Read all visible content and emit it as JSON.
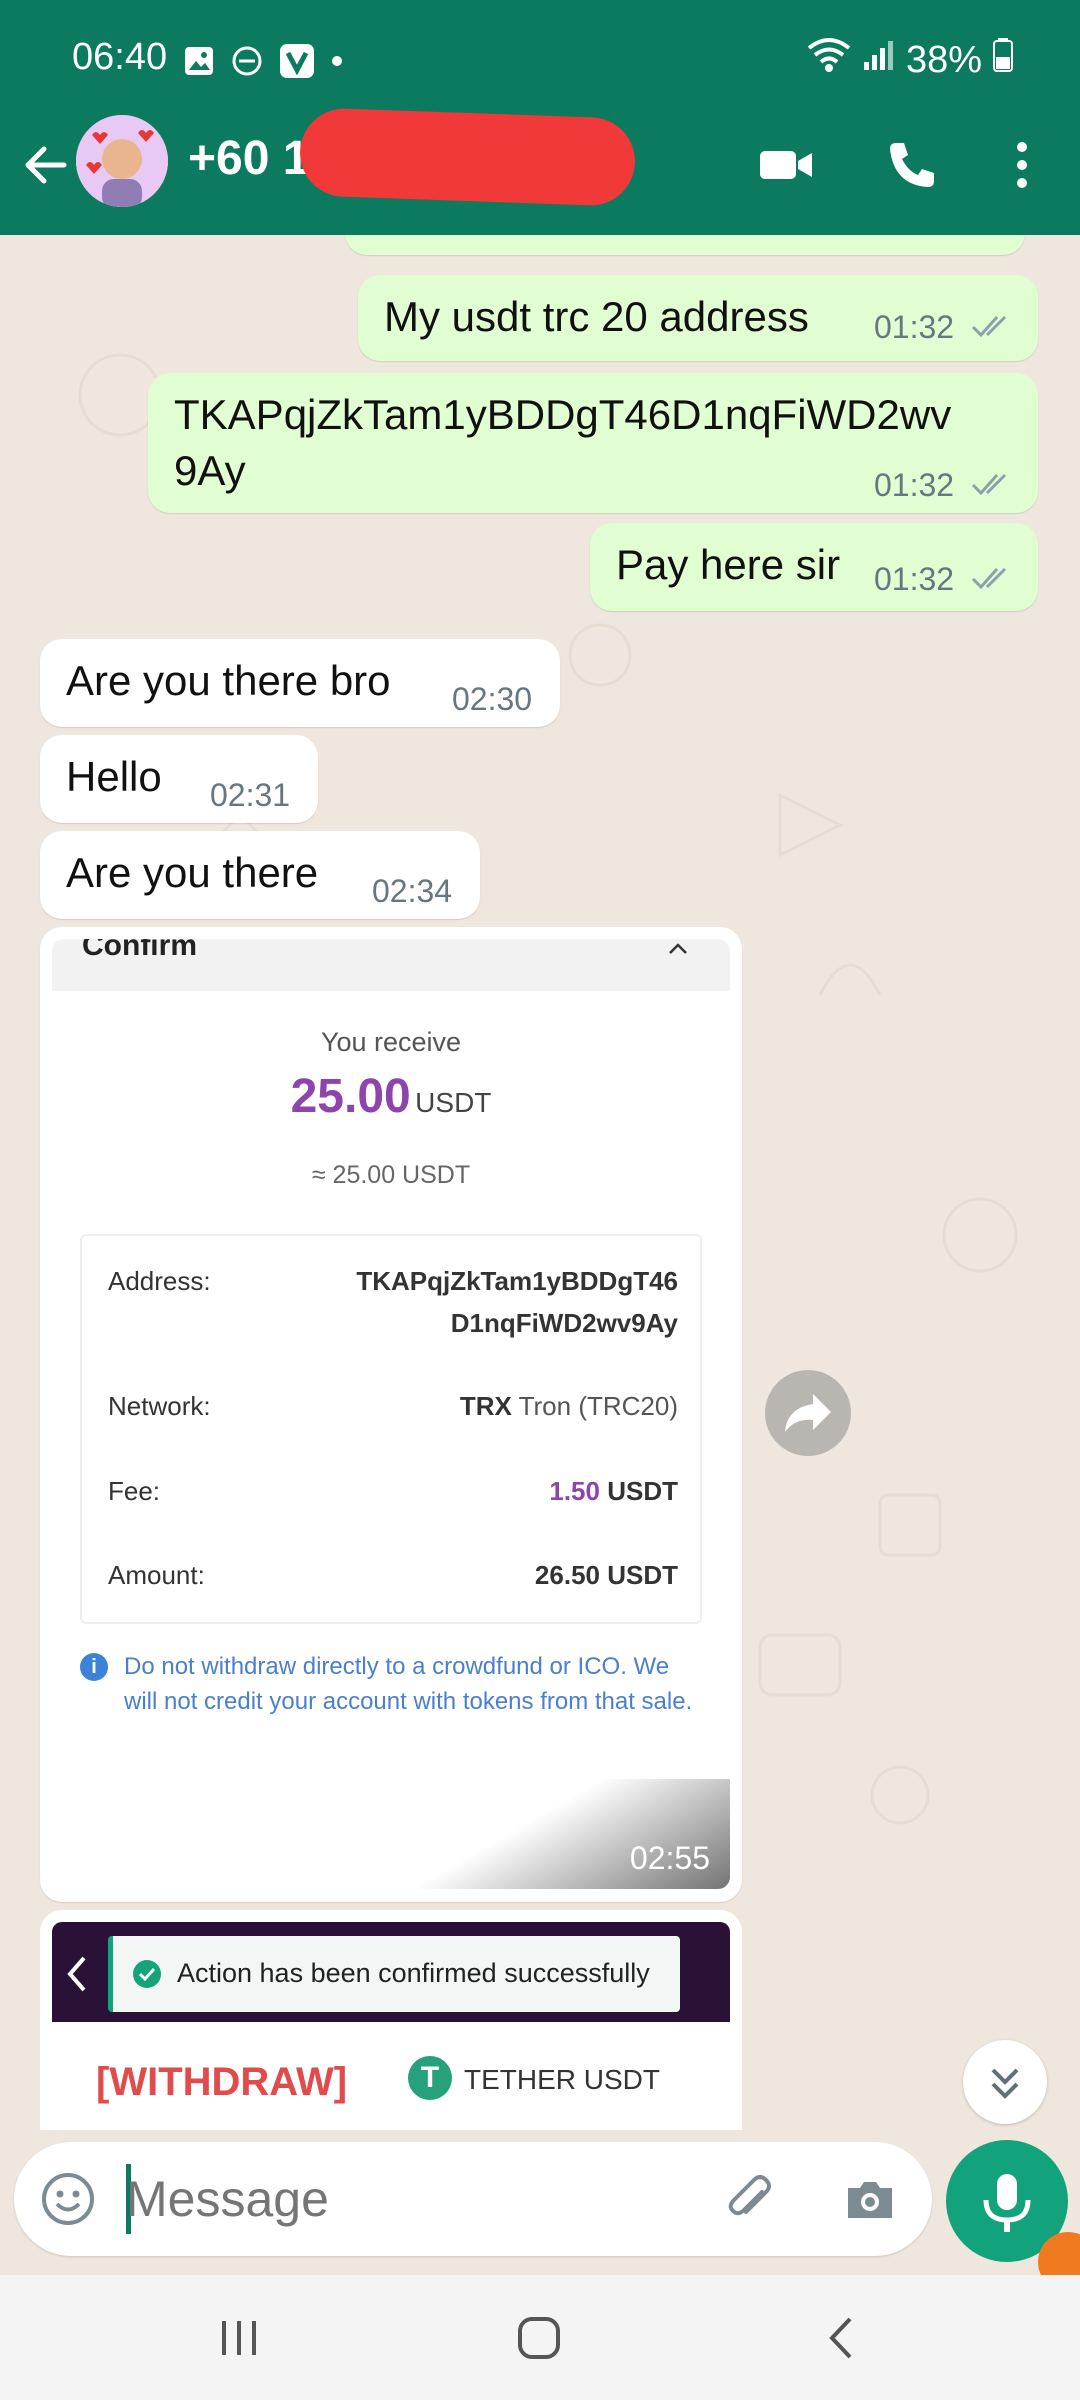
{
  "status_bar": {
    "time": "06:40",
    "battery": "38%",
    "icons": [
      "image-icon",
      "dnd-icon",
      "v-app-icon",
      "dot-icon",
      "wifi-icon",
      "signal-icon",
      "battery-icon"
    ]
  },
  "header": {
    "contact_name": "+60 1",
    "icons": [
      "back-arrow-icon",
      "video-call-icon",
      "phone-icon",
      "more-vert-icon"
    ]
  },
  "messages": [
    {
      "dir": "out",
      "text": "My usdt trc 20 address",
      "time": "01:32"
    },
    {
      "dir": "out",
      "text_line1": "TKAPqjZkTam1yBDDgT46D1nqFiWD2wv",
      "text_line2": "9Ay",
      "time": "01:32"
    },
    {
      "dir": "out",
      "text": "Pay here sir",
      "time": "01:32"
    },
    {
      "dir": "in",
      "text": "Are you there bro",
      "time": "02:30"
    },
    {
      "dir": "in",
      "text": "Hello",
      "time": "02:31"
    },
    {
      "dir": "in",
      "text": "Are you there",
      "time": "02:34"
    }
  ],
  "receipt": {
    "header": "Confirm",
    "you_receive_label": "You receive",
    "amount": "25.00",
    "amount_unit": "USDT",
    "approx": "≈ 25.00 USDT",
    "rows": [
      {
        "key": "Address:",
        "value_line1": "TKAPqjZkTam1yBDDgT46",
        "value_line2": "D1nqFiWD2wv9Ay"
      },
      {
        "key": "Network:",
        "value_bold": "TRX",
        "value_rest": "Tron (TRC20)"
      },
      {
        "key": "Fee:",
        "value_accent": "1.50",
        "value_unit": "USDT"
      },
      {
        "key": "Amount:",
        "value": "26.50 USDT"
      }
    ],
    "notice": "Do not withdraw directly to a crowdfund or ICO. We will not credit your account with tokens from that sale.",
    "time": "02:55"
  },
  "second_image": {
    "toast": "Action has been confirmed successfully",
    "withdraw_label": "[WITHDRAW]",
    "coin_label": "TETHER USDT"
  },
  "input": {
    "placeholder": "Message"
  },
  "colors": {
    "header_bg": "#0b7a5f",
    "outgoing_bubble": "#e1fdd2",
    "incoming_bubble": "#ffffff",
    "chat_bg": "#efe7dd",
    "accent_purple": "#8e44ad",
    "mic_button": "#12a37c",
    "redaction": "#f2393a"
  }
}
